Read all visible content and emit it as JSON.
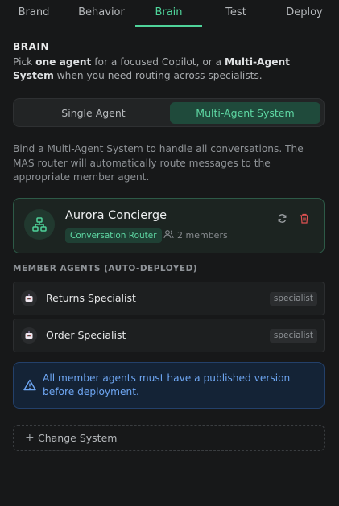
{
  "tabs": [
    {
      "label": "Brand",
      "active": false
    },
    {
      "label": "Behavior",
      "active": false
    },
    {
      "label": "Brain",
      "active": true
    },
    {
      "label": "Test",
      "active": false
    },
    {
      "label": "Deploy",
      "active": false
    }
  ],
  "section": {
    "title": "BRAIN",
    "intro_pre": "Pick ",
    "intro_bold1": "one agent",
    "intro_mid": " for a focused Copilot, or a ",
    "intro_bold2": "Multi-Agent System",
    "intro_post": " when you need routing across specialists."
  },
  "mode_toggle": {
    "single_label": "Single Agent",
    "multi_label": "Multi-Agent System",
    "selected": "Multi-Agent System"
  },
  "description": "Bind a Multi-Agent System to handle all conversations. The MAS router will automatically route messages to the appropriate member agent.",
  "mas_card": {
    "name": "Aurora Concierge",
    "router_badge": "Conversation Router",
    "members": "2 members",
    "icon": "hierarchy-icon"
  },
  "members_section": {
    "heading": "MEMBER AGENTS (AUTO-DEPLOYED)",
    "items": [
      {
        "name": "Returns Specialist",
        "tag": "specialist",
        "icon": "robot-icon"
      },
      {
        "name": "Order Specialist",
        "tag": "specialist",
        "icon": "robot-icon"
      }
    ]
  },
  "alert": {
    "text": "All member agents must have a published version before deployment.",
    "icon": "warning-icon"
  },
  "change_button": {
    "label": "Change System",
    "icon": "plus-icon"
  },
  "colors": {
    "background": "#171819",
    "accent": "#4fd39a",
    "danger": "#e05252",
    "info": "#6ea6f2"
  }
}
